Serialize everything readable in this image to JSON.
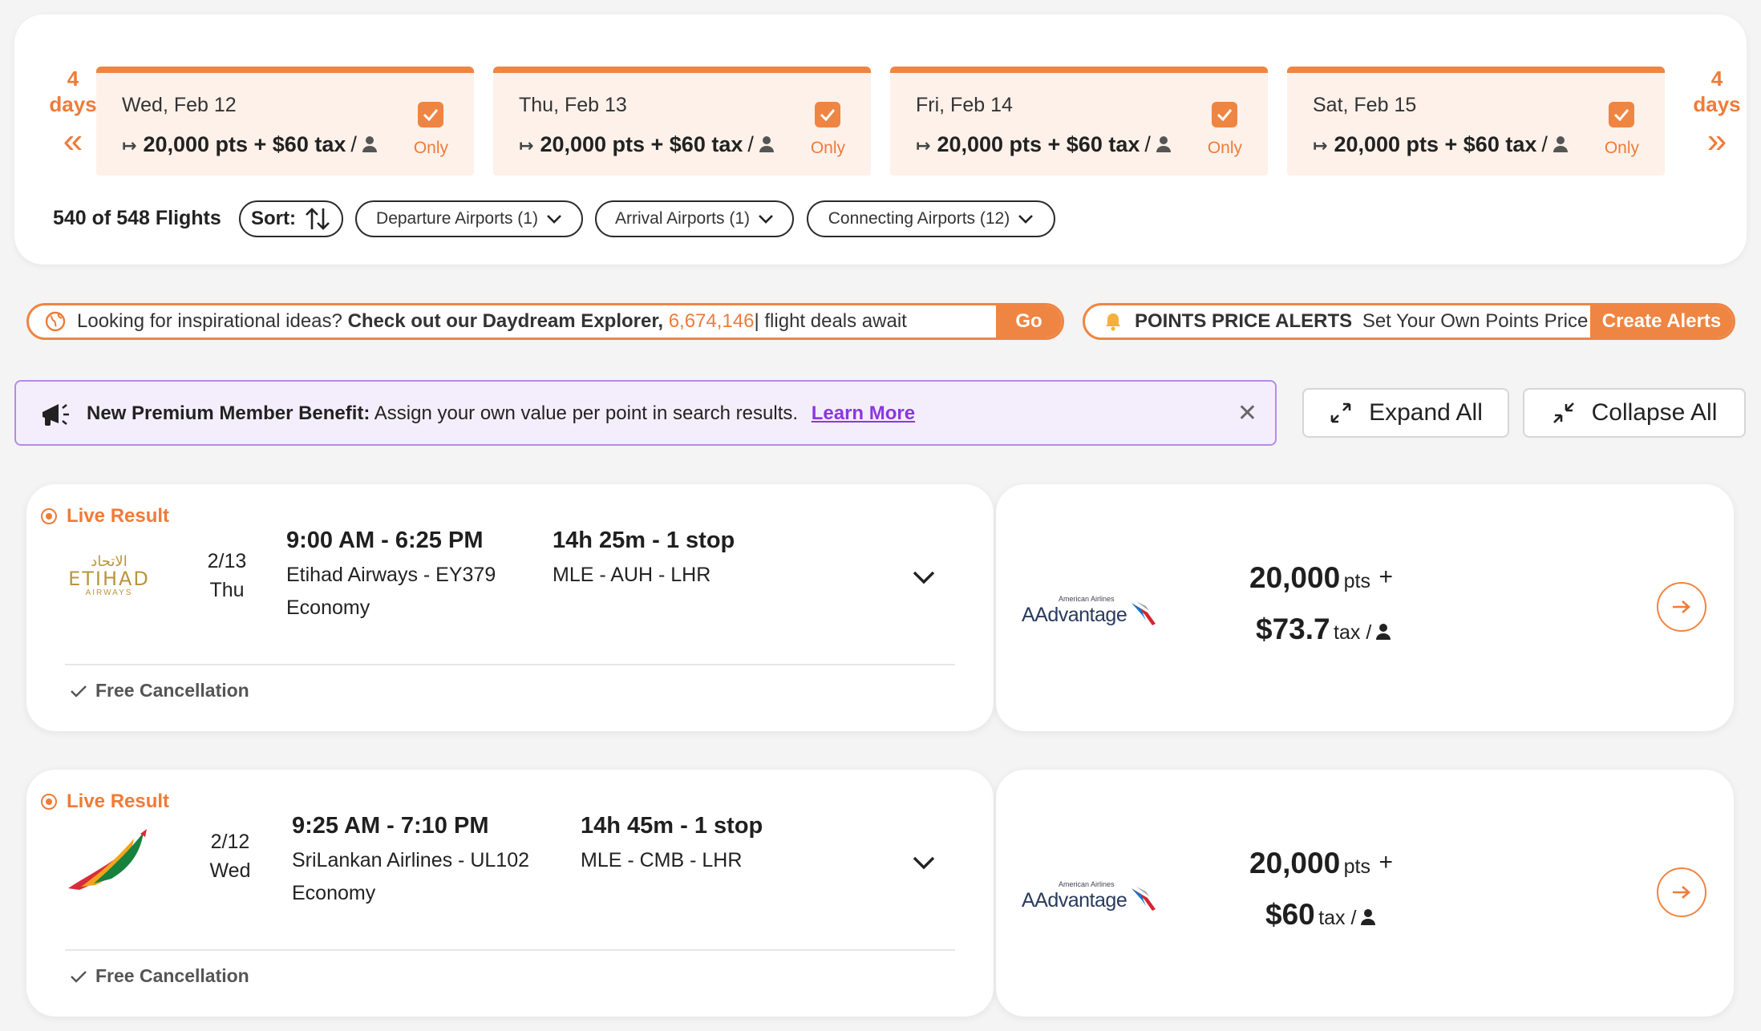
{
  "date_nav": {
    "prev_label": "4 days",
    "next_label": "4 days",
    "cards": [
      {
        "date": "Wed, Feb 12",
        "price": "20,000 pts + $60 tax",
        "only": "Only"
      },
      {
        "date": "Thu, Feb 13",
        "price": "20,000 pts + $60 tax",
        "only": "Only"
      },
      {
        "date": "Fri, Feb 14",
        "price": "20,000 pts + $60 tax",
        "only": "Only"
      },
      {
        "date": "Sat, Feb 15",
        "price": "20,000 pts + $60 tax",
        "only": "Only"
      }
    ]
  },
  "filters": {
    "count": "540 of 548 Flights",
    "sort_label": "Sort:",
    "departure": "Departure Airports (1)",
    "arrival": "Arrival Airports (1)",
    "connecting": "Connecting Airports (12)"
  },
  "inspiration": {
    "lead": "Looking for inspirational ideas?",
    "bold": "Check out our Daydream Explorer,",
    "count": "6,674,146",
    "tail": "| flight deals await",
    "button": "Go"
  },
  "alerts": {
    "bold": "POINTS PRICE ALERTS",
    "text": "Set Your Own Points Price",
    "button": "Create Alerts"
  },
  "premium": {
    "bold": "New Premium Member Benefit:",
    "text": "Assign your own value per point in search results.",
    "link": "Learn More"
  },
  "actions": {
    "expand": "Expand All",
    "collapse": "Collapse All"
  },
  "results": [
    {
      "live": "Live Result",
      "airline_logo": "etihad-logo",
      "logo_arabic": "الاتحاد",
      "logo_name": "ETIHAD",
      "logo_sub": "AIRWAYS",
      "date": "2/13",
      "day": "Thu",
      "time": "9:00 AM - 6:25 PM",
      "flight": "Etihad Airways - EY379",
      "cabin": "Economy",
      "duration": "14h 25m - 1 stop",
      "route": "MLE - AUH - LHR",
      "free_cancel": "Free Cancellation",
      "program": "AAdvantage",
      "program_small": "American Airlines",
      "points": "20,000",
      "pts_unit": "pts",
      "plus": "+",
      "tax": "$73.7",
      "tax_unit": "tax /"
    },
    {
      "live": "Live Result",
      "airline_logo": "srilankan-logo",
      "date": "2/12",
      "day": "Wed",
      "time": "9:25 AM - 7:10 PM",
      "flight": "SriLankan Airlines - UL102",
      "cabin": "Economy",
      "duration": "14h 45m - 1 stop",
      "route": "MLE - CMB - LHR",
      "free_cancel": "Free Cancellation",
      "program": "AAdvantage",
      "program_small": "American Airlines",
      "points": "20,000",
      "pts_unit": "pts",
      "plus": "+",
      "tax": "$60",
      "tax_unit": "tax /"
    }
  ],
  "colors": {
    "accent": "#ef8542",
    "purple": "#8a37e0"
  }
}
